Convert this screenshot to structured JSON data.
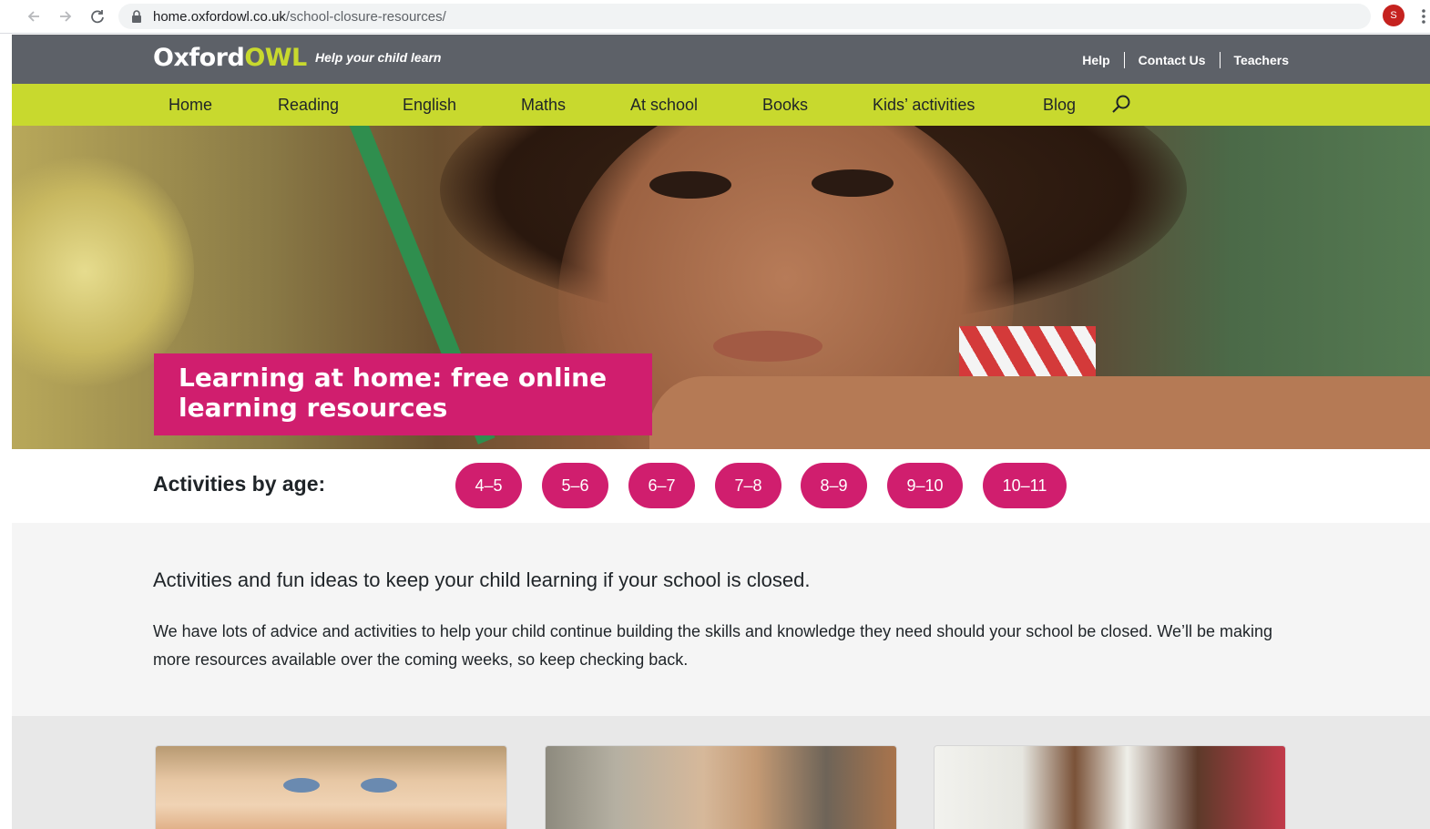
{
  "browser": {
    "url_host": "home.oxfordowl.co.uk",
    "url_path": "/school-closure-resources/",
    "profile_initial": "S"
  },
  "header": {
    "logo_text": "Oxford",
    "logo_owl": "OWL",
    "tagline": "Help your child learn",
    "top_links": [
      "Help",
      "Contact Us",
      "Teachers"
    ]
  },
  "nav": {
    "items": [
      "Home",
      "Reading",
      "English",
      "Maths",
      "At school",
      "Books",
      "Kids’ activities",
      "Blog"
    ]
  },
  "hero": {
    "title_line1": "Learning at home: free online",
    "title_line2": "learning resources"
  },
  "ages": {
    "label": "Activities by age:",
    "buttons": [
      "4–5",
      "5–6",
      "6–7",
      "7–8",
      "8–9",
      "9–10",
      "10–11"
    ]
  },
  "intro": {
    "lead": "Activities and fun ideas to keep your child learning if your school is closed.",
    "body": "We have lots of advice and activities to help your child continue building the skills and knowledge they need should your school be closed. We’ll be making more resources available over the coming weeks, so keep checking back."
  },
  "colors": {
    "header_grey": "#5d6168",
    "nav_lime": "#c8d92e",
    "accent_pink": "#d01e6e"
  }
}
